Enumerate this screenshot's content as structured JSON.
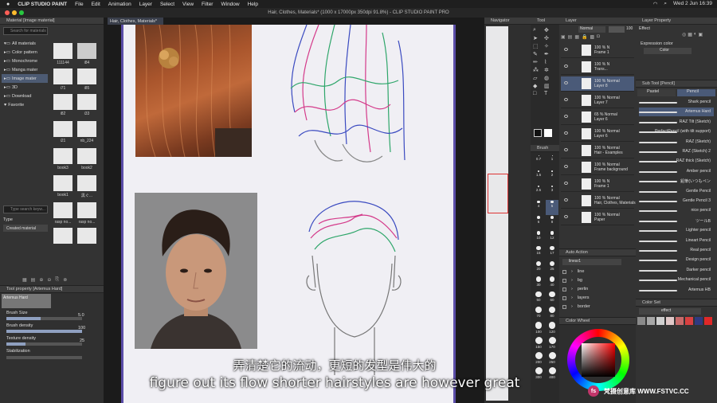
{
  "menubar": {
    "app": "CLIP STUDIO PAINT",
    "items": [
      "File",
      "Edit",
      "Animation",
      "Layer",
      "Select",
      "View",
      "Filter",
      "Window",
      "Help"
    ],
    "clock": "Wed 2 Jun  16:39"
  },
  "window": {
    "title": "Hair, Clothes, Materials* (1000 x 17000px 350dpi 91.8%)  - CLIP STUDIO PAINT PRO",
    "doc_tab": "Hair, Clothes, Materials*"
  },
  "material_panel": {
    "header": "Material [Image material]",
    "search_placeholder": "Search for materials",
    "tree": [
      "All materials",
      "Color pattern",
      "Monochrome",
      "Manga mater",
      "Image mater",
      "3D",
      "Download",
      "Favorite"
    ],
    "thumbs": [
      "111144",
      "i84",
      "i71",
      "i85",
      "i82",
      "i33",
      "i21",
      "i3",
      "nb_224",
      "book3",
      "book2",
      "book1",
      "黒ぐ...",
      "rasp no...",
      "rasp no..."
    ],
    "tag_search_placeholder": "Type search keyw...",
    "type_label": "Type",
    "type_value": "Created material"
  },
  "tool_property": {
    "header": "Tool property [Artemus Hard]",
    "brush_name": "Artemus Hard",
    "rows": [
      {
        "label": "Brush Size",
        "value": "5.0",
        "fill": 0.45
      },
      {
        "label": "Brush density",
        "value": "100",
        "fill": 1.0
      },
      {
        "label": "Texture density",
        "value": "25",
        "fill": 0.25
      },
      {
        "label": "Stabilization",
        "value": "",
        "fill": 0.0
      }
    ]
  },
  "navigator": {
    "header": "Navigator"
  },
  "tool_panel": {
    "header": "Tool",
    "brush_header": "Brush",
    "sizes": [
      "0.7",
      "1",
      "1.5",
      "2",
      "2.5",
      "3",
      "4",
      "5",
      "6",
      "8",
      "10",
      "12",
      "15",
      "17",
      "20",
      "25",
      "30",
      "40",
      "50",
      "60",
      "70",
      "80",
      "100",
      "120",
      "150",
      "170",
      "200",
      "250",
      "300",
      "400"
    ]
  },
  "layer_panel": {
    "header": "Layer",
    "blend": "Normal",
    "opacity": "100",
    "layers": [
      {
        "line1": "100 % N",
        "line2": "Frame 1",
        "selected": false
      },
      {
        "line1": "100 % N",
        "line2": "Trans...",
        "selected": false
      },
      {
        "line1": "100 % Normal",
        "line2": "Layer 8",
        "selected": true
      },
      {
        "line1": "100 % Normal",
        "line2": "Layer 7",
        "selected": false
      },
      {
        "line1": "65 % Normal",
        "line2": "Layer 6",
        "selected": false
      },
      {
        "line1": "100 % Normal",
        "line2": "Layer 6",
        "selected": false
      },
      {
        "line1": "100 % Normal",
        "line2": "Hair - Examples",
        "selected": false
      },
      {
        "line1": "100 % Normal",
        "line2": "Frame background",
        "selected": false
      },
      {
        "line1": "100 % N",
        "line2": "Frame 1",
        "selected": false
      },
      {
        "line1": "100 % Normal",
        "line2": "Hair, Clothes, Materials",
        "selected": false
      },
      {
        "line1": "100 % Normal",
        "line2": "Paper",
        "selected": false
      }
    ]
  },
  "auto_action": {
    "header": "Auto Action",
    "set": "linear1",
    "items": [
      "line",
      "bg",
      "perlin",
      "layers",
      "border"
    ]
  },
  "color_wheel": {
    "header": "Color Wheel"
  },
  "layer_property": {
    "header": "Layer Property",
    "effect_label": "Effect",
    "expression_label": "Expression color",
    "expression_value": "Color"
  },
  "sub_tool": {
    "header": "Sub Tool [Pencil]",
    "tabs": [
      "Pastel",
      "Pencil"
    ],
    "items": [
      {
        "name": "Shark pencil",
        "selected": false
      },
      {
        "name": "Artemus Hard",
        "selected": true
      },
      {
        "name": "RAZ Tilt (Sketch)",
        "selected": false
      },
      {
        "name": "PerfectPencil (with tilt support)",
        "selected": false
      },
      {
        "name": "RAZ (Sketch)",
        "selected": false
      },
      {
        "name": "RAZ (Sketch) 2",
        "selected": false
      },
      {
        "name": "RAZ thick (Sketch)",
        "selected": false
      },
      {
        "name": "Amber pencil",
        "selected": false
      },
      {
        "name": "鉛筆(いつもペン",
        "selected": false
      },
      {
        "name": "Gentle Pencil",
        "selected": false
      },
      {
        "name": "Gentle Pencil 3",
        "selected": false
      },
      {
        "name": "nice pencil",
        "selected": false
      },
      {
        "name": "ツールB",
        "selected": false
      },
      {
        "name": "Lighter pencil",
        "selected": false
      },
      {
        "name": "Lineart Pencil",
        "selected": false
      },
      {
        "name": "Real pencil",
        "selected": false
      },
      {
        "name": "Design pencil",
        "selected": false
      },
      {
        "name": "Darker pencil",
        "selected": false
      },
      {
        "name": "Mechanical pencil",
        "selected": false
      },
      {
        "name": "Artemus HB",
        "selected": false
      }
    ]
  },
  "color_set": {
    "header": "Color Set",
    "set_name": "effect",
    "swatches": [
      "#8a8a8a",
      "#a7a7a7",
      "#cfcfcf",
      "#e0c8c8",
      "#c86a6a",
      "#d94040",
      "#303a80",
      "#e02828"
    ]
  },
  "subtitle": {
    "zh": "弄清楚它的流动，更短的发型是伟大的",
    "en": "figure out its flow shorter hairstyles are however great"
  },
  "watermark": {
    "logo": "fs",
    "text": "梵摄创意库  WWW.FSTVC.CC"
  },
  "colors": {
    "accent_purple": "#5b4da8",
    "selection_blue": "#4a5a78"
  }
}
